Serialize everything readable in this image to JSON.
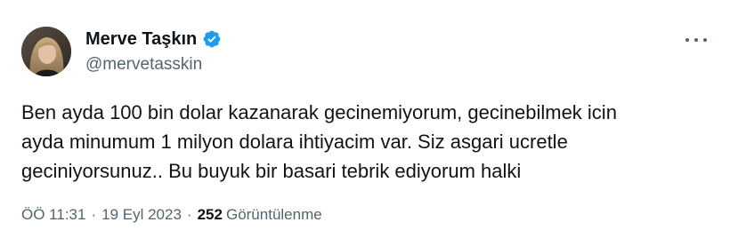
{
  "author": {
    "display_name": "Merve Taşkın",
    "handle": "@mervetasskin",
    "verified_icon": "verified-badge-icon",
    "verified_color": "#1d9bf0"
  },
  "tweet": {
    "lines": [
      "Ben ayda 100 bin dolar kazanarak gecinemiyorum, gecinebilmek icin",
      "ayda minumum 1 milyon dolara ihtiyacim var. Siz asgari ucretle",
      "geciniyorsunuz.. Bu buyuk bir basari tebrik ediyorum halki"
    ]
  },
  "meta": {
    "time": "ÖÖ 11:31",
    "separator": "·",
    "date": "19 Eyl 2023",
    "views_count": "252",
    "views_label": "Görüntülenme"
  },
  "colors": {
    "text_primary": "#0f1419",
    "text_secondary": "#536471",
    "accent": "#1d9bf0"
  }
}
